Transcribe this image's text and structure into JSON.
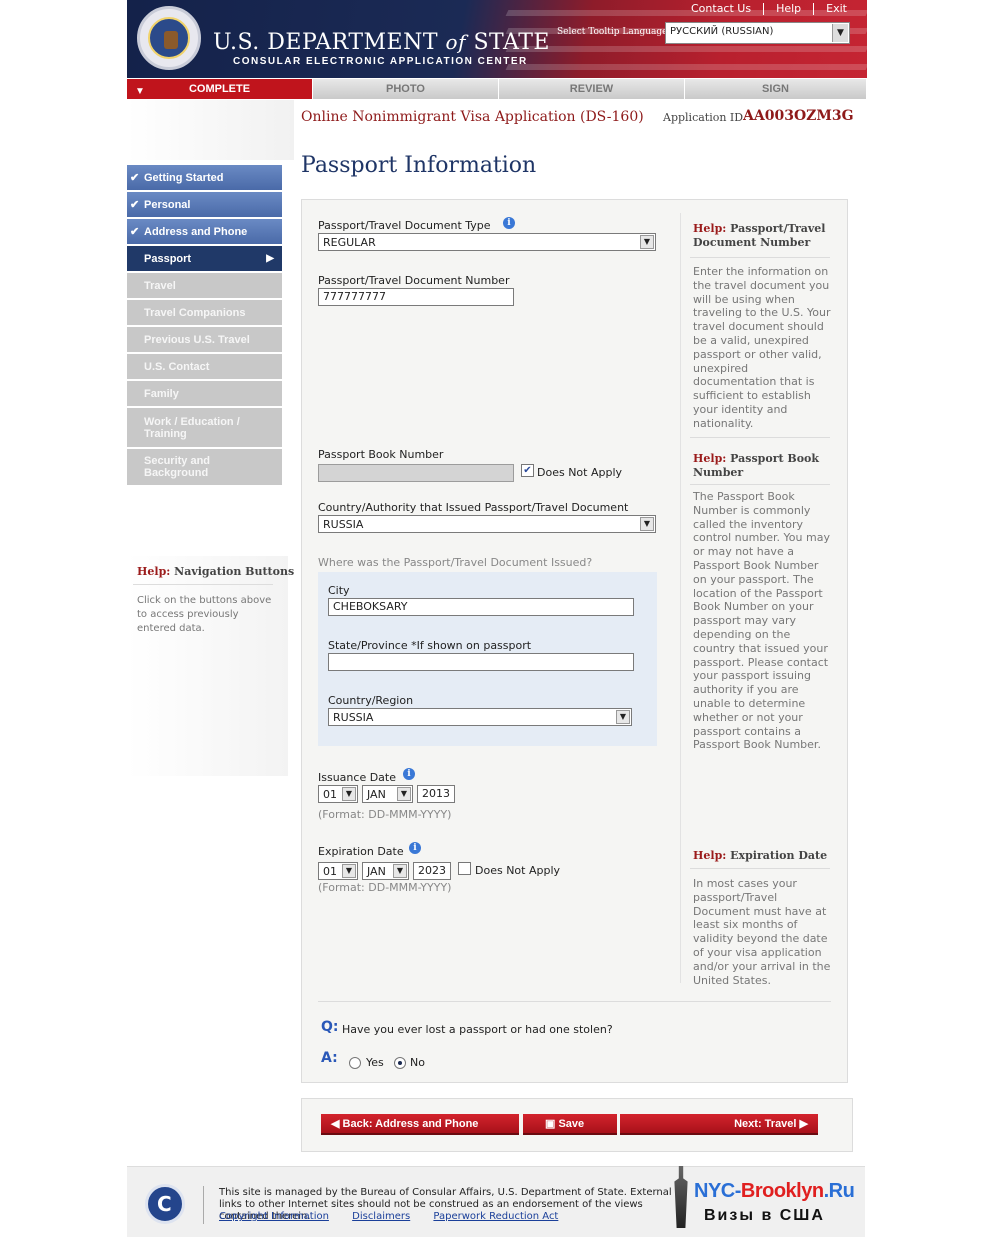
{
  "header": {
    "title_main_1": "U.S. DEPARTMENT",
    "title_main_of": "of",
    "title_main_2": "STATE",
    "title_sub": "CONSULAR ELECTRONIC APPLICATION CENTER",
    "links": [
      "Contact Us",
      "Help",
      "Exit"
    ],
    "tooltip_label": "Select Tooltip Language",
    "tooltip_language": "РУССКИЙ (RUSSIAN)"
  },
  "tabs": [
    {
      "label": "COMPLETE",
      "active": true
    },
    {
      "label": "PHOTO",
      "active": false
    },
    {
      "label": "REVIEW",
      "active": false
    },
    {
      "label": "SIGN",
      "active": false
    }
  ],
  "app": {
    "title": "Online Nonimmigrant Visa Application (DS-160)",
    "id_label": "Application ID",
    "id": "AA003OZM3G"
  },
  "page_title": "Passport Information",
  "nav": {
    "items": [
      {
        "label": "Getting Started",
        "state": "done"
      },
      {
        "label": "Personal",
        "state": "done"
      },
      {
        "label": "Address and Phone",
        "state": "done"
      },
      {
        "label": "Passport",
        "state": "current"
      },
      {
        "label": "Travel",
        "state": "todo"
      },
      {
        "label": "Travel Companions",
        "state": "todo"
      },
      {
        "label": "Previous U.S. Travel",
        "state": "todo"
      },
      {
        "label": "U.S. Contact",
        "state": "todo"
      },
      {
        "label": "Family",
        "state": "todo"
      },
      {
        "label": "Work / Education / Training",
        "state": "todo"
      },
      {
        "label": "Security and Background",
        "state": "todo"
      }
    ]
  },
  "left_help": {
    "prefix": "Help:",
    "title": "Navigation Buttons",
    "text": "Click on the buttons above to access previously entered data."
  },
  "form": {
    "doc_type_label": "Passport/Travel Document Type",
    "doc_type_value": "REGULAR",
    "doc_number_label": "Passport/Travel Document Number",
    "doc_number_value": "777777777",
    "book_number_label": "Passport Book Number",
    "book_number_value": "",
    "does_not_apply": "Does Not Apply",
    "country_label": "Country/Authority that Issued Passport/Travel Document",
    "country_value": "RUSSIA",
    "issued_where": "Where was the Passport/Travel Document Issued?",
    "city_label": "City",
    "city_value": "CHEBOKSARY",
    "state_label": "State/Province *If shown on passport",
    "state_value": "",
    "region_label": "Country/Region",
    "region_value": "RUSSIA",
    "issuance_label": "Issuance Date",
    "issuance_day": "01",
    "issuance_month": "JAN",
    "issuance_year": "2013",
    "format_hint": "(Format: DD-MMM-YYYY)",
    "expiration_label": "Expiration Date",
    "expiration_day": "01",
    "expiration_month": "JAN",
    "expiration_year": "2023",
    "q_marker": "Q:",
    "a_marker": "A:",
    "question": "Have you ever lost a passport or had one stolen?",
    "answer_yes": "Yes",
    "answer_no": "No",
    "answer_selected": "No"
  },
  "help": {
    "prefix": "Help:",
    "doc_number_title": "Passport/Travel Document Number",
    "doc_number_text": "Enter the information on the travel document you will be using when traveling to the U.S. Your travel document should be a valid, unexpired passport or other valid, unexpired documentation that is sufficient to establish your identity and nationality.",
    "book_number_title": "Passport Book Number",
    "book_number_text": "The Passport Book Number is commonly called the inventory control number. You may or may not have a Passport Book Number on your passport. The location of the Passport Book Number on your passport may vary depending on the country that issued your passport. Please contact your passport issuing authority if you are unable to determine whether or not your passport contains a Passport Book Number.",
    "expiration_title": "Expiration Date",
    "expiration_text": "In most cases your passport/Travel Document must have at least six months of validity beyond the date of your visa application and/or your arrival in the United States."
  },
  "buttons": {
    "back": "Back: Address and Phone",
    "save": "Save",
    "next": "Next: Travel"
  },
  "footer": {
    "text": "This site is managed by the Bureau of Consular Affairs, U.S. Department of State. External links to other Internet sites should not be construed as an endorsement of the views contained therein.",
    "links": [
      "Copyright Information",
      "Disclaimers",
      "Paperwork Reduction Act"
    ]
  },
  "watermark": {
    "line1_a": "NYC-",
    "line1_b": "Brooklyn",
    "line1_c": ".Ru",
    "line2": "Визы в США"
  },
  "colors": {
    "nav_done": "#5878b6",
    "nav_current": "#203968",
    "brand_red": "#c0141c",
    "title_blue": "#1f3566"
  }
}
